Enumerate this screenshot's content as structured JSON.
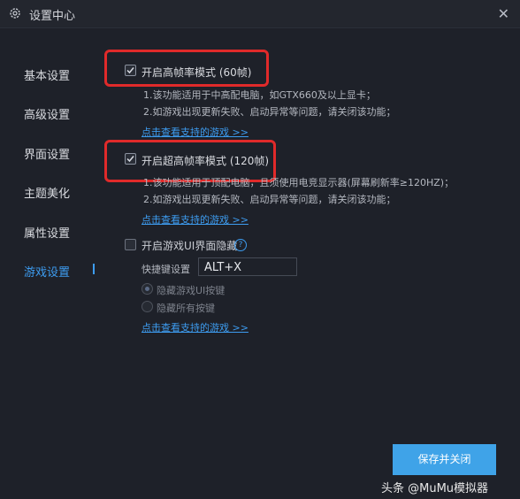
{
  "window": {
    "title": "设置中心",
    "close_glyph": "✕"
  },
  "sidebar": {
    "items": [
      {
        "label": "基本设置",
        "active": false
      },
      {
        "label": "高级设置",
        "active": false
      },
      {
        "label": "界面设置",
        "active": false
      },
      {
        "label": "主题美化",
        "active": false
      },
      {
        "label": "属性设置",
        "active": false
      },
      {
        "label": "游戏设置",
        "active": true
      }
    ]
  },
  "game": {
    "high_fps": {
      "label": "开启高帧率模式 (60帧)",
      "checked": true,
      "desc1": "1.该功能适用于中高配电脑，如GTX660及以上显卡；",
      "desc2": "2.如游戏出现更新失败、启动异常等问题，请关闭该功能；",
      "link": "点击查看支持的游戏 >>"
    },
    "ultra_fps": {
      "label": "开启超高帧率模式 (120帧)",
      "checked": true,
      "desc1": "1.该功能适用于顶配电脑，且须使用电竞显示器(屏幕刷新率≥120HZ)；",
      "desc2": "2.如游戏出现更新失败、启动异常等问题，请关闭该功能；",
      "link": "点击查看支持的游戏 >>"
    },
    "hide_ui": {
      "label": "开启游戏UI界面隐藏",
      "checked": false,
      "help": "?",
      "hotkey_label": "快捷键设置",
      "hotkey_value": "ALT+X",
      "radio1": "隐藏游戏UI按键",
      "radio2": "隐藏所有按键",
      "link": "点击查看支持的游戏 >>"
    }
  },
  "footer": {
    "save_label": "保存并关闭"
  },
  "watermark": "头条 @MuMu模拟器",
  "colors": {
    "accent": "#3d9cf0",
    "highlight": "#e02a2a",
    "background": "#1e2129"
  }
}
